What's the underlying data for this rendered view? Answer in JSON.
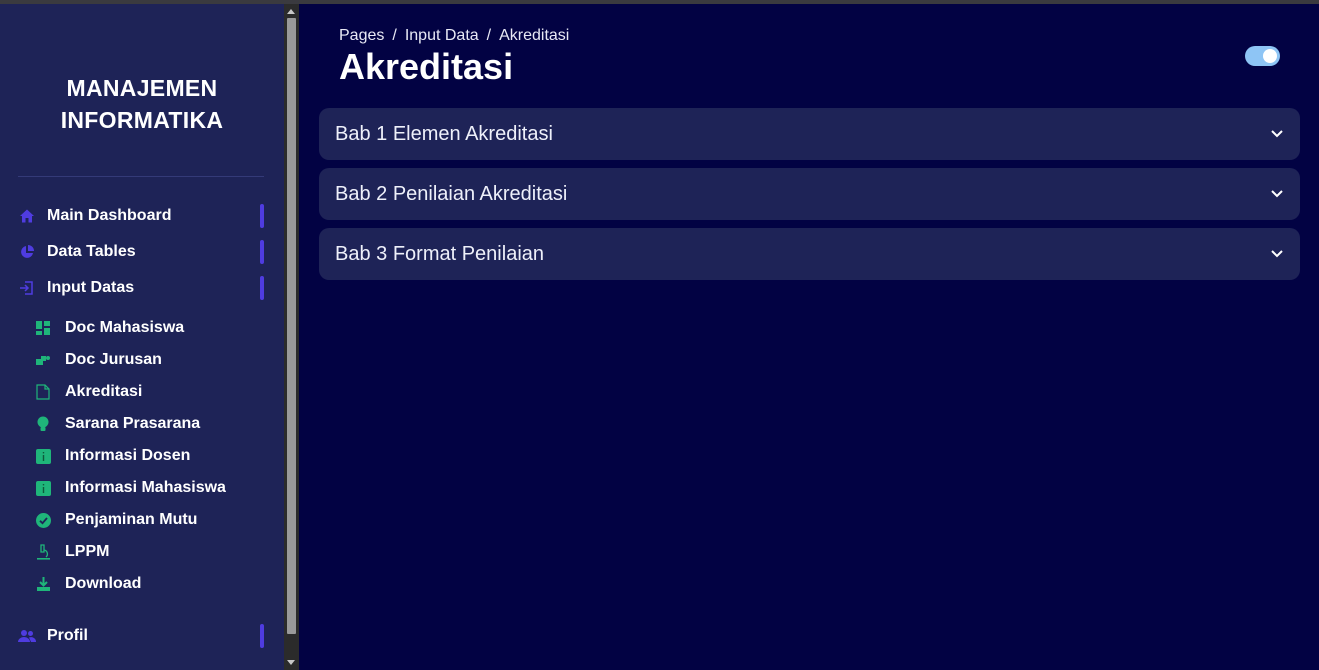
{
  "sidebar": {
    "brand_line1": "MANAJEMEN",
    "brand_line2": "INFORMATIKA",
    "main_items": [
      {
        "label": "Main Dashboard",
        "icon": "home-icon"
      },
      {
        "label": "Data Tables",
        "icon": "pie-chart-icon"
      },
      {
        "label": "Input Datas",
        "icon": "sign-in-icon"
      },
      {
        "label": "Profil",
        "icon": "users-icon"
      }
    ],
    "sub_items": [
      {
        "label": "Doc Mahasiswa",
        "icon": "dashboard-grid-icon"
      },
      {
        "label": "Doc Jurusan",
        "icon": "shapes-icon"
      },
      {
        "label": "Akreditasi",
        "icon": "doc-file-icon"
      },
      {
        "label": "Sarana Prasarana",
        "icon": "lightbulb-icon"
      },
      {
        "label": "Informasi Dosen",
        "icon": "info-box-icon"
      },
      {
        "label": "Informasi Mahasiswa",
        "icon": "info-box-icon"
      },
      {
        "label": "Penjaminan Mutu",
        "icon": "check-circle-icon"
      },
      {
        "label": "LPPM",
        "icon": "microscope-icon"
      },
      {
        "label": "Download",
        "icon": "download-icon"
      }
    ]
  },
  "header": {
    "breadcrumb": [
      "Pages",
      "/",
      "Input Data",
      "/",
      "Akreditasi"
    ],
    "title": "Akreditasi"
  },
  "accordions": [
    {
      "label": "Bab 1 Elemen Akreditasi"
    },
    {
      "label": "Bab 2 Penilaian Akreditasi"
    },
    {
      "label": "Bab 3 Format Penilaian"
    }
  ],
  "colors": {
    "background": "#020243",
    "sidebar": "#1e2357",
    "accent_purple": "#4f3ce0",
    "accent_green": "#1fb57a",
    "toggle": "#8ec5f5"
  }
}
